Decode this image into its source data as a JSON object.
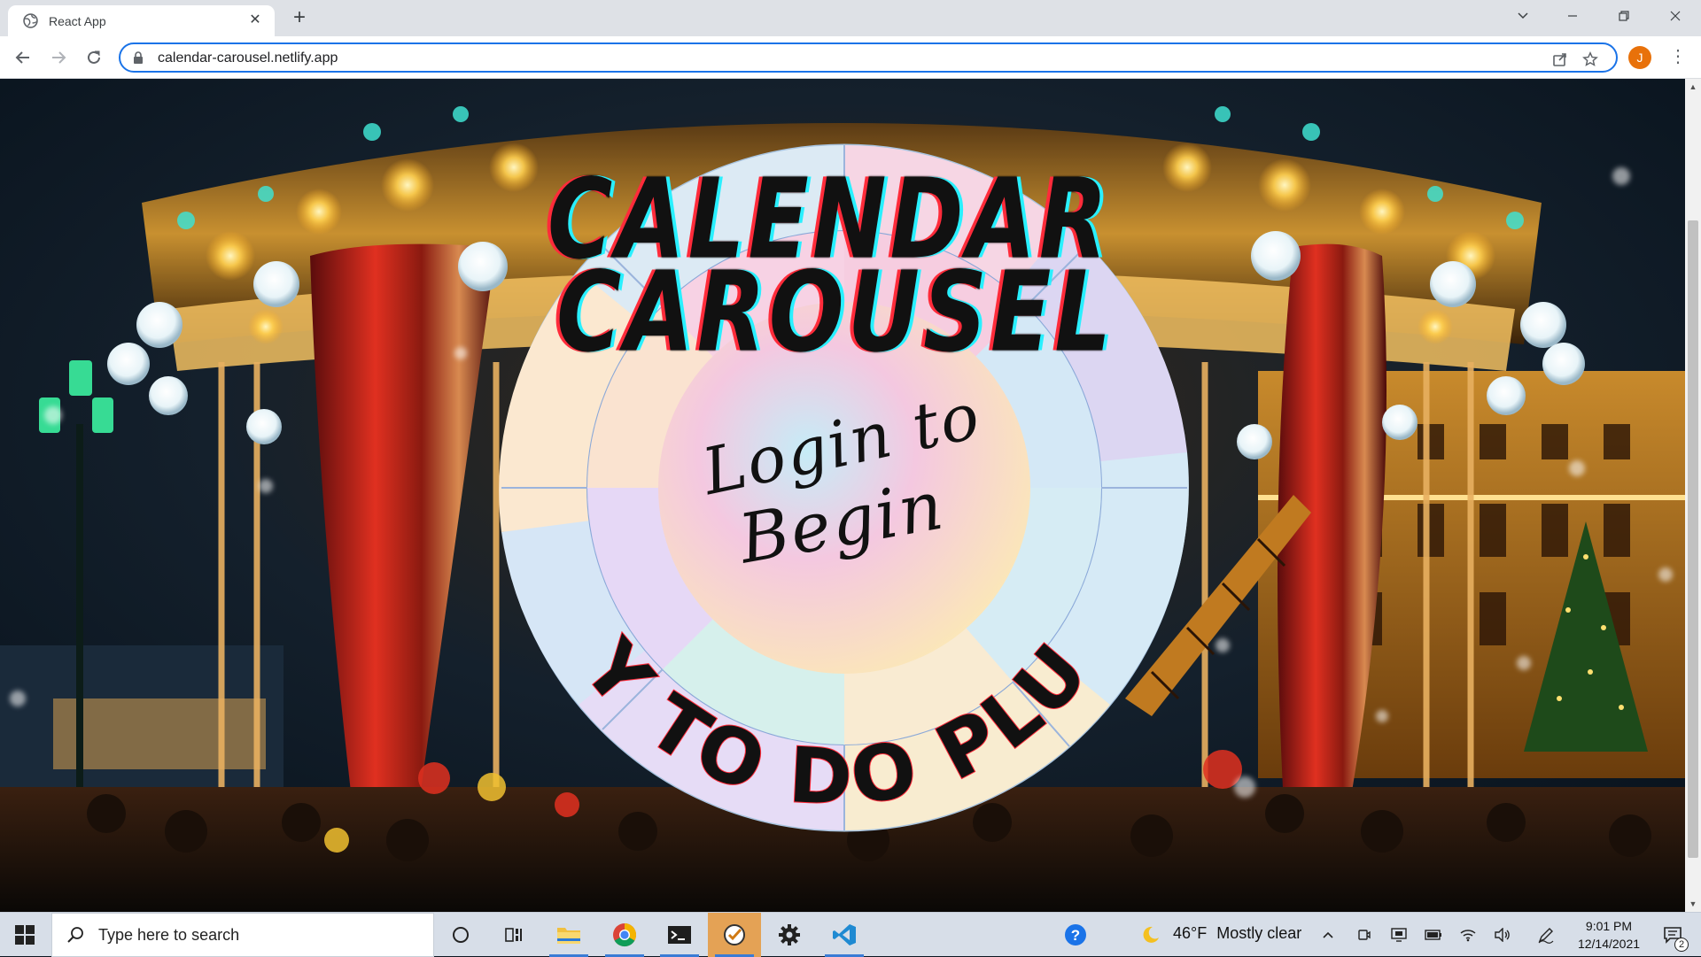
{
  "browser": {
    "tab_title": "React App",
    "url": "calendar-carousel.netlify.app",
    "profile_initial": "J"
  },
  "page": {
    "title_line1": "CALENDAR",
    "title_line2": "CAROUSEL",
    "center_line1": "Login to",
    "center_line2": "Begin",
    "footer": "BY TO DO PLUS"
  },
  "taskbar": {
    "search_placeholder": "Type here to search",
    "weather_temp": "46°F",
    "weather_desc": "Mostly clear",
    "time": "9:01 PM",
    "date": "12/14/2021",
    "notifications": "2"
  },
  "colors": {
    "accent": "#1a73e8",
    "title_fill": "#111111",
    "title_shadow_red": "#ff2b3a",
    "title_shadow_cyan": "#29f0ff"
  }
}
